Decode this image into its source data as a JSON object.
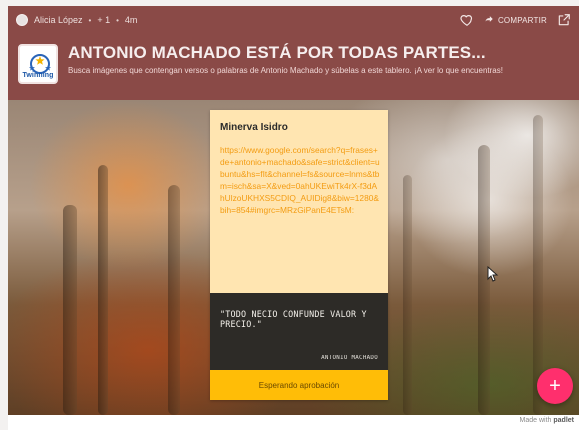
{
  "topbar": {
    "user": "Alicia López",
    "likes": "+ 1",
    "time": "4m",
    "share_label": "COMPARTIR"
  },
  "header": {
    "logo_text": "Twinning",
    "title": "ANTONIO MACHADO ESTÁ POR TODAS PARTES...",
    "subtitle": "Busca imágenes que contengan versos o palabras de Antonio Machado y súbelas a este tablero. ¡A ver lo que encuentras!"
  },
  "card": {
    "author": "Minerva Isidro",
    "link": "https://www.google.com/search?q=frases+de+antonio+machado&safe=strict&client=ubuntu&hs=fIt&channel=fs&source=lnms&tbm=isch&sa=X&ved=0ahUKEwiTk4rX-f3dAhUlzoUKHXS5CDIQ_AUIDig8&biw=1280&bih=854#imgrc=MRzGiPanE4ETsM:",
    "quote": "\"TODO NECIO CONFUNDE VALOR Y PRECIO.\"",
    "quote_attribution": "ANTONIO MACHADO",
    "status": "Esperando aprobación"
  },
  "fab": {
    "label": "+"
  },
  "footer": {
    "made_with": "Made with",
    "brand": "padlet"
  },
  "colors": {
    "header_bg": "#8a4a47",
    "card_bg": "#ffe5b1",
    "link": "#f39c12",
    "status_bg": "#ffbd07",
    "fab_bg": "#ff2f6d"
  }
}
